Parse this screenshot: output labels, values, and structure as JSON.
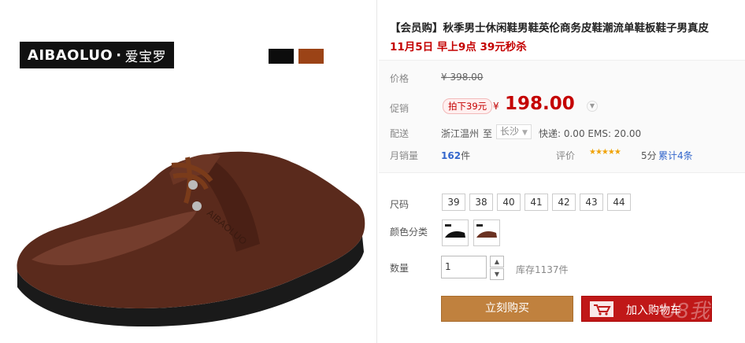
{
  "brand": {
    "logo_text": "AIBAOLUO",
    "logo_cn": "爱宝罗",
    "swatch_colors": [
      "#0c0c0c",
      "#9b4316"
    ],
    "shoe_text": "AIBAOLUO"
  },
  "product": {
    "title": "【会员购】秋季男士休闲鞋男鞋英伦商务皮鞋潮流单鞋板鞋子男真皮",
    "promo": "11月5日 早上9点 39元秒杀"
  },
  "pricing": {
    "price_label": "价格",
    "original_price": "¥ 398.00",
    "promo_label": "促销",
    "discount_tag": "拍下39元",
    "currency": "¥",
    "sale_price": "198.00"
  },
  "shipping": {
    "label": "配送",
    "origin": "浙江温州",
    "to": "至",
    "destination": "长沙",
    "fees": "快递: 0.00 EMS: 20.00"
  },
  "sales": {
    "label": "月销量",
    "count": "162",
    "unit": "件",
    "rating_label": "评价",
    "stars": "★★★★★",
    "score": "5分",
    "reviews": "累计4条"
  },
  "options": {
    "size_label": "尺码",
    "sizes": [
      "39",
      "38",
      "40",
      "41",
      "42",
      "43",
      "44"
    ],
    "color_label": "颜色分类"
  },
  "quantity": {
    "label": "数量",
    "value": "1",
    "up": "▲",
    "down": "▼",
    "stock": "库存1137件"
  },
  "actions": {
    "buy": "立刻购买",
    "cart": "加入购物车",
    "watermark": "U8我"
  },
  "icons": {
    "cart": "cart-icon",
    "chevron": "chevron-down-icon"
  }
}
